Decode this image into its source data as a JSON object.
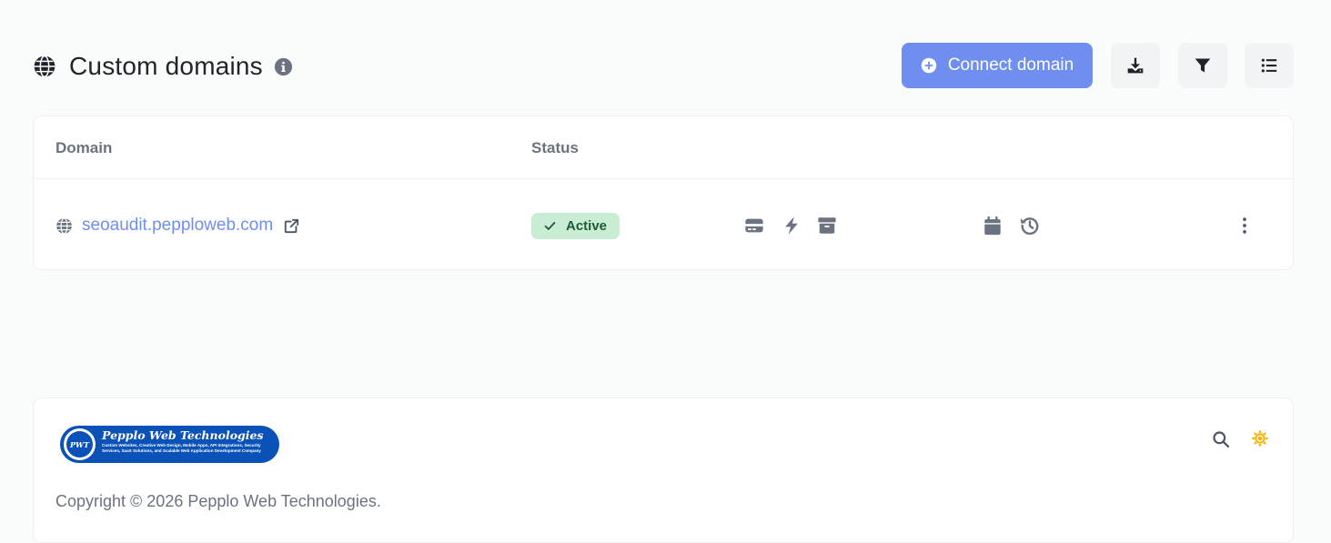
{
  "header": {
    "title": "Custom domains",
    "title_icon": "globe-icon",
    "info_icon": "info-circle-icon",
    "connect_button_label": "Connect domain",
    "connect_button_icon": "plus-circle-icon",
    "toolbar_icons": [
      "download-icon",
      "filter-icon",
      "list-icon"
    ]
  },
  "table": {
    "columns": [
      "Domain",
      "Status"
    ],
    "rows": [
      {
        "domain": "seoaudit.pepploweb.com",
        "status": "Active",
        "action_icons": [
          "card-icon",
          "bolt-icon",
          "archive-icon",
          "calendar-icon",
          "history-icon",
          "more-vertical-icon"
        ]
      }
    ]
  },
  "footer": {
    "logo": {
      "name": "Pepplo Web Technologies",
      "mark": "PWT",
      "tagline": "Custom Websites, Creative Web Design, Mobile Apps, API Integrations, Security Services, SaaS Solutions, and Scalable Web Application Development Company"
    },
    "copyright": "Copyright © 2026 Pepplo Web Technologies.",
    "icons": [
      "search-icon",
      "sun-icon"
    ]
  },
  "colors": {
    "accent": "#6f8ff0",
    "status_active_bg": "#c9ecd4",
    "status_active_text": "#1c5b33",
    "icon_gray": "#6b7280",
    "theme_icon": "#f3b400",
    "logo_blue": "#0a52b8"
  }
}
